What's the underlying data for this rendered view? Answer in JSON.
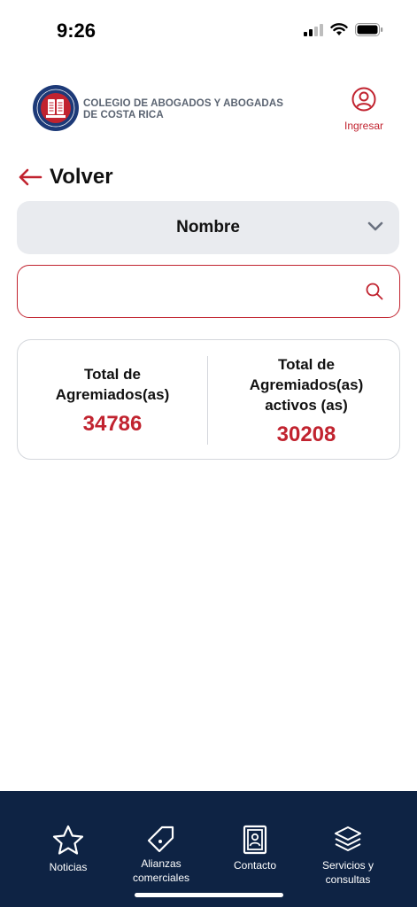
{
  "status_bar": {
    "time": "9:26"
  },
  "header": {
    "org_name_line1": "COLEGIO DE ABOGADOS Y ABOGADAS",
    "org_name_line2": "DE COSTA RICA",
    "login_label": "Ingresar"
  },
  "back": {
    "label": "Volver"
  },
  "filter": {
    "selected": "Nombre"
  },
  "search": {
    "value": "",
    "placeholder": ""
  },
  "stats": {
    "total_label_line1": "Total de",
    "total_label_line2": "Agremiados(as)",
    "total_value": "34786",
    "active_label_line1": "Total de",
    "active_label_line2": "Agremiados(as)",
    "active_label_line3": "activos (as)",
    "active_value": "30208"
  },
  "bottom_nav": {
    "items": [
      {
        "icon": "star-icon",
        "line1": "Noticias",
        "line2": ""
      },
      {
        "icon": "tag-icon",
        "line1": "Alianzas",
        "line2": "comerciales"
      },
      {
        "icon": "contact-book-icon",
        "line1": "Contacto",
        "line2": ""
      },
      {
        "icon": "layers-icon",
        "line1": "Servicios y",
        "line2": "consultas"
      }
    ]
  },
  "colors": {
    "accent": "#c1232f",
    "nav_bg": "#0e2344",
    "select_bg": "#e9ebef"
  }
}
